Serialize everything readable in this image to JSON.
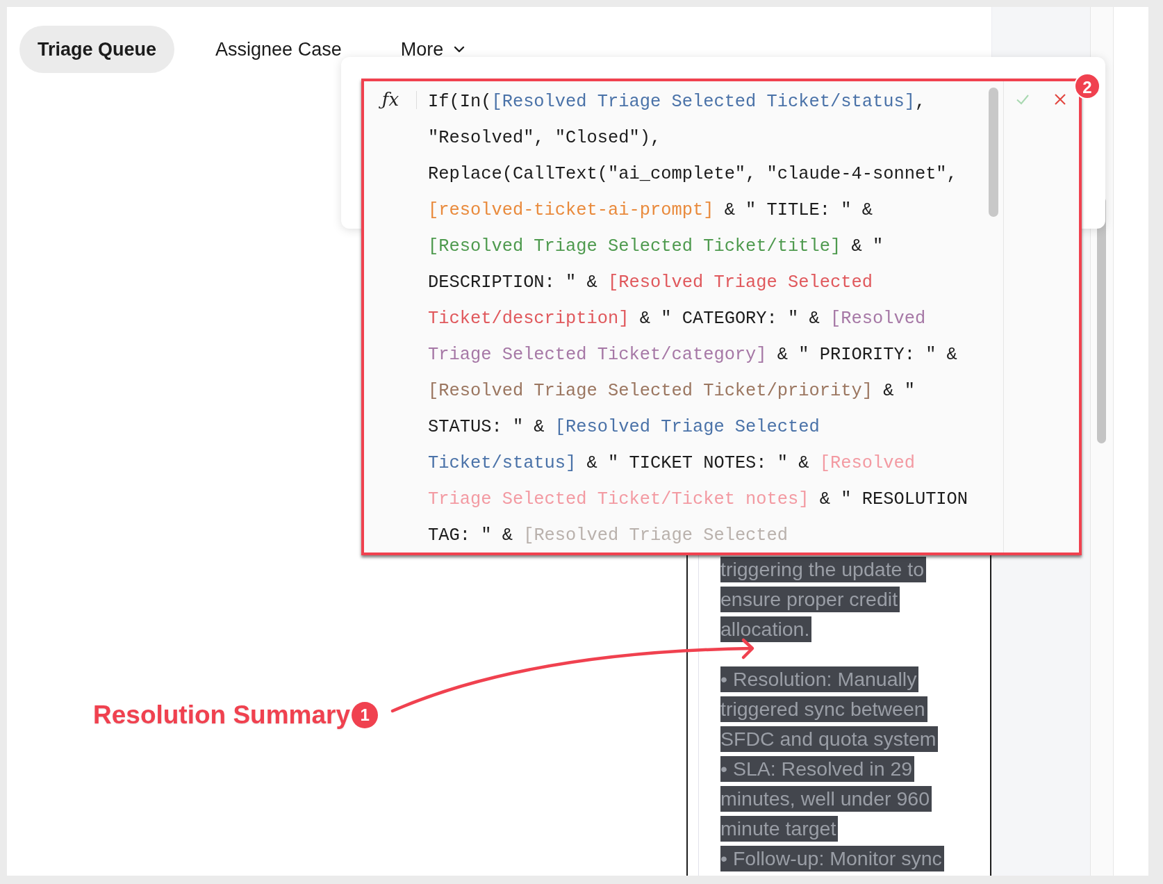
{
  "tabs": [
    {
      "label": "Triage Queue",
      "selected": true,
      "kind": "tab"
    },
    {
      "label": "Assignee Case",
      "selected": false,
      "kind": "tab"
    },
    {
      "label": "More",
      "selected": false,
      "kind": "dropdown"
    }
  ],
  "formula_editor": {
    "icon": "ƒx",
    "callout_number": "2",
    "lines": [
      [
        {
          "text": "If(In(",
          "color": "#1c1c1c"
        },
        {
          "text": "[Resolved Triage Selected Ticket/status]",
          "color": "#4a72a8"
        },
        {
          "text": ",",
          "color": "#1c1c1c"
        }
      ],
      [
        {
          "text": "\"Resolved\", \"Closed\"),",
          "color": "#1c1c1c"
        }
      ],
      [
        {
          "text": "Replace(CallText(\"ai_complete\", \"claude-4-sonnet\",",
          "color": "#1c1c1c"
        }
      ],
      [
        {
          "text": "[resolved-ticket-ai-prompt]",
          "color": "#e98a3c"
        },
        {
          "text": " & \" TITLE: \" &",
          "color": "#1c1c1c"
        }
      ],
      [
        {
          "text": "[Resolved Triage Selected Ticket/title]",
          "color": "#4e9a4e"
        },
        {
          "text": " & \"",
          "color": "#1c1c1c"
        }
      ],
      [
        {
          "text": "DESCRIPTION: \" & ",
          "color": "#1c1c1c"
        },
        {
          "text": "[Resolved Triage Selected",
          "color": "#e0585c"
        }
      ],
      [
        {
          "text": "Ticket/description]",
          "color": "#e0585c"
        },
        {
          "text": " & \" CATEGORY: \" & ",
          "color": "#1c1c1c"
        },
        {
          "text": "[Resolved",
          "color": "#a678a6"
        }
      ],
      [
        {
          "text": "Triage Selected Ticket/category]",
          "color": "#a678a6"
        },
        {
          "text": " & \" PRIORITY: \" &",
          "color": "#1c1c1c"
        }
      ],
      [
        {
          "text": "[Resolved Triage Selected Ticket/priority]",
          "color": "#9b7660"
        },
        {
          "text": " & \"",
          "color": "#1c1c1c"
        }
      ],
      [
        {
          "text": "STATUS: \" & ",
          "color": "#1c1c1c"
        },
        {
          "text": "[Resolved Triage Selected",
          "color": "#4a72a8"
        }
      ],
      [
        {
          "text": "Ticket/status]",
          "color": "#4a72a8"
        },
        {
          "text": " & \" TICKET NOTES: \" & ",
          "color": "#1c1c1c"
        },
        {
          "text": "[Resolved",
          "color": "#f39aa2"
        }
      ],
      [
        {
          "text": "Triage Selected Ticket/Ticket notes]",
          "color": "#f39aa2"
        },
        {
          "text": " & \" RESOLUTION",
          "color": "#1c1c1c"
        }
      ],
      [
        {
          "text": "TAG: \" & ",
          "color": "#1c1c1c"
        },
        {
          "text": "[Resolved Triage Selected",
          "color": "#b9b1ac"
        }
      ]
    ]
  },
  "selected_text": {
    "paragraphs": [
      [
        "triggering the update to",
        "ensure proper credit",
        "allocation."
      ],
      [
        "• Resolution: Manually",
        "triggered sync between",
        "SFDC and quota system",
        "• SLA: Resolved in 29",
        "minutes, well under 960",
        "minute target",
        "• Follow-up: Monitor sync"
      ]
    ]
  },
  "callouts": [
    {
      "number": "1",
      "label": "Resolution Summary"
    }
  ]
}
